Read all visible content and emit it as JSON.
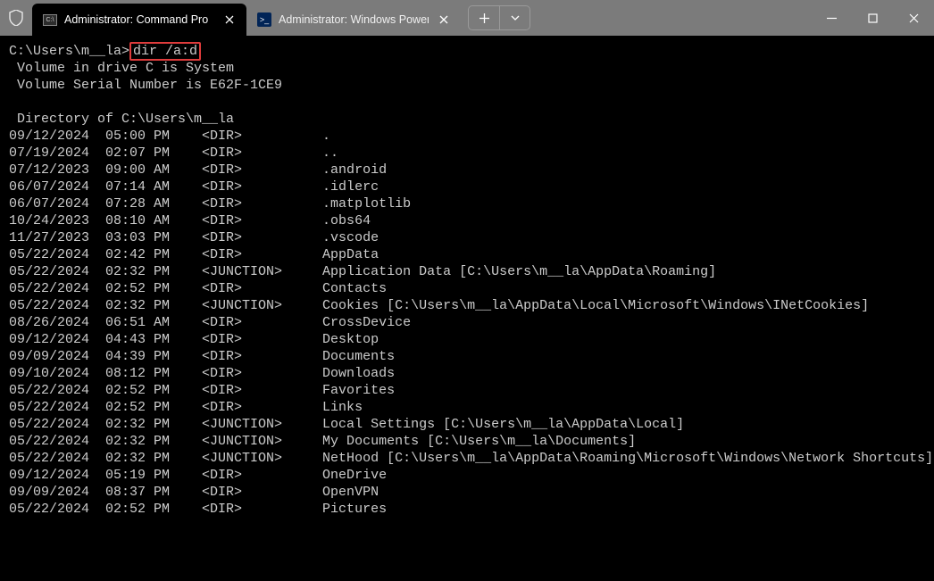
{
  "titlebar": {
    "tabs": [
      {
        "label": "Administrator: Command Pro",
        "icon": "cmd-icon",
        "active": true
      },
      {
        "label": "Administrator: Windows Power",
        "icon": "powershell-icon",
        "active": false
      }
    ],
    "new_tab": "+",
    "dropdown": "⌄"
  },
  "terminal": {
    "prompt_path": "C:\\Users\\m__la>",
    "command": "dir /a:d",
    "header": [
      " Volume in drive C is System",
      " Volume Serial Number is E62F-1CE9",
      "",
      " Directory of C:\\Users\\m__la",
      ""
    ],
    "entries": [
      {
        "date": "09/12/2024",
        "time": "05:00 PM",
        "type": "<DIR>",
        "name": "."
      },
      {
        "date": "07/19/2024",
        "time": "02:07 PM",
        "type": "<DIR>",
        "name": ".."
      },
      {
        "date": "07/12/2023",
        "time": "09:00 AM",
        "type": "<DIR>",
        "name": ".android"
      },
      {
        "date": "06/07/2024",
        "time": "07:14 AM",
        "type": "<DIR>",
        "name": ".idlerc"
      },
      {
        "date": "06/07/2024",
        "time": "07:28 AM",
        "type": "<DIR>",
        "name": ".matplotlib"
      },
      {
        "date": "10/24/2023",
        "time": "08:10 AM",
        "type": "<DIR>",
        "name": ".obs64"
      },
      {
        "date": "11/27/2023",
        "time": "03:03 PM",
        "type": "<DIR>",
        "name": ".vscode"
      },
      {
        "date": "05/22/2024",
        "time": "02:42 PM",
        "type": "<DIR>",
        "name": "AppData"
      },
      {
        "date": "05/22/2024",
        "time": "02:32 PM",
        "type": "<JUNCTION>",
        "name": "Application Data [C:\\Users\\m__la\\AppData\\Roaming]"
      },
      {
        "date": "05/22/2024",
        "time": "02:52 PM",
        "type": "<DIR>",
        "name": "Contacts"
      },
      {
        "date": "05/22/2024",
        "time": "02:32 PM",
        "type": "<JUNCTION>",
        "name": "Cookies [C:\\Users\\m__la\\AppData\\Local\\Microsoft\\Windows\\INetCookies]"
      },
      {
        "date": "08/26/2024",
        "time": "06:51 AM",
        "type": "<DIR>",
        "name": "CrossDevice"
      },
      {
        "date": "09/12/2024",
        "time": "04:43 PM",
        "type": "<DIR>",
        "name": "Desktop"
      },
      {
        "date": "09/09/2024",
        "time": "04:39 PM",
        "type": "<DIR>",
        "name": "Documents"
      },
      {
        "date": "09/10/2024",
        "time": "08:12 PM",
        "type": "<DIR>",
        "name": "Downloads"
      },
      {
        "date": "05/22/2024",
        "time": "02:52 PM",
        "type": "<DIR>",
        "name": "Favorites"
      },
      {
        "date": "05/22/2024",
        "time": "02:52 PM",
        "type": "<DIR>",
        "name": "Links"
      },
      {
        "date": "05/22/2024",
        "time": "02:32 PM",
        "type": "<JUNCTION>",
        "name": "Local Settings [C:\\Users\\m__la\\AppData\\Local]"
      },
      {
        "date": "05/22/2024",
        "time": "02:32 PM",
        "type": "<JUNCTION>",
        "name": "My Documents [C:\\Users\\m__la\\Documents]"
      },
      {
        "date": "05/22/2024",
        "time": "02:32 PM",
        "type": "<JUNCTION>",
        "name": "NetHood [C:\\Users\\m__la\\AppData\\Roaming\\Microsoft\\Windows\\Network Shortcuts]"
      },
      {
        "date": "09/12/2024",
        "time": "05:19 PM",
        "type": "<DIR>",
        "name": "OneDrive"
      },
      {
        "date": "09/09/2024",
        "time": "08:37 PM",
        "type": "<DIR>",
        "name": "OpenVPN"
      },
      {
        "date": "05/22/2024",
        "time": "02:52 PM",
        "type": "<DIR>",
        "name": "Pictures"
      }
    ]
  }
}
